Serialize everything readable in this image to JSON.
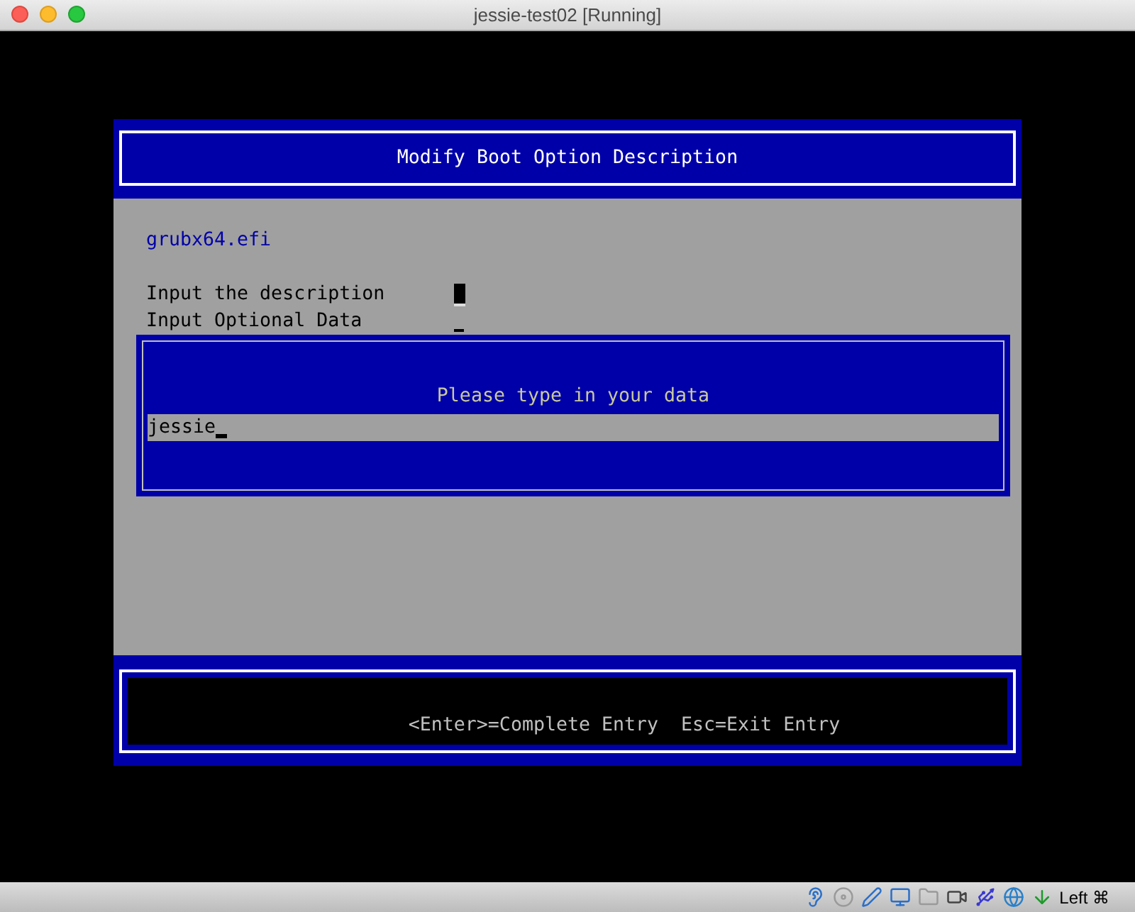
{
  "window": {
    "title": "jessie-test02 [Running]"
  },
  "screen": {
    "title": "Modify Boot Option Description",
    "file": "grubx64.efi",
    "fields": [
      {
        "label": "Input the description",
        "selected": true
      },
      {
        "label": "Input Optional Data",
        "selected": false
      }
    ],
    "dialog": {
      "prompt": "Please type in your data",
      "value": "jessie"
    },
    "footer": "<Enter>=Complete Entry  Esc=Exit Entry"
  },
  "status_bar": {
    "host_key": "Left ⌘"
  }
}
